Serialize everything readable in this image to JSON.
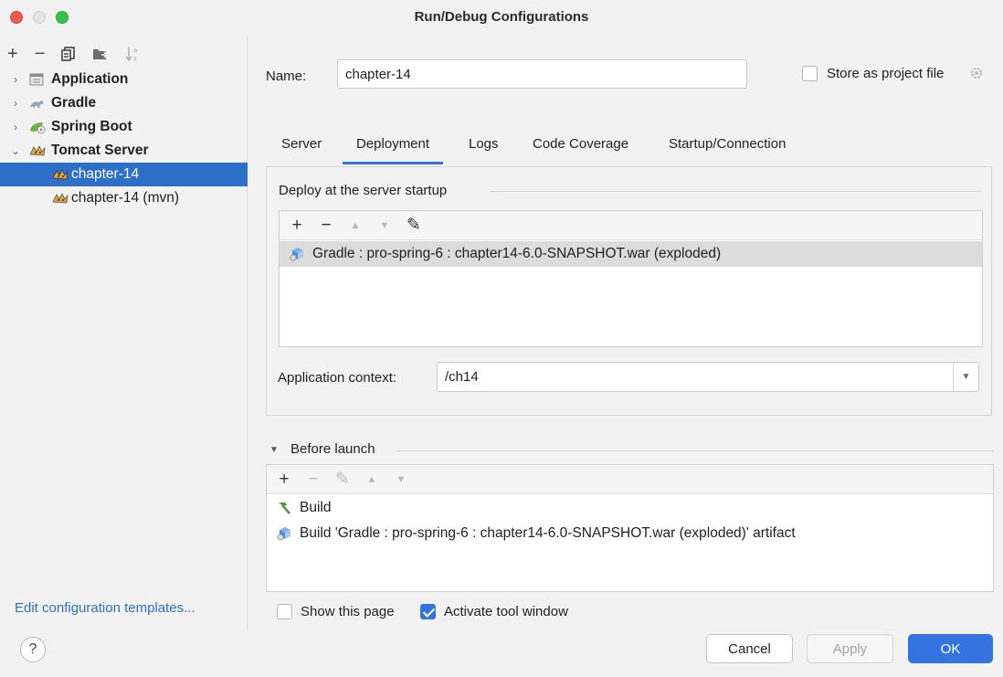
{
  "window": {
    "title": "Run/Debug Configurations"
  },
  "sidebar": {
    "toolbar": [
      {
        "name": "add-icon",
        "label": "+"
      },
      {
        "name": "remove-icon",
        "label": "−"
      },
      {
        "name": "copy-icon"
      },
      {
        "name": "move-to-folder-icon"
      },
      {
        "name": "sort-icon"
      }
    ],
    "tree": [
      {
        "label": "Application",
        "chevron": "›",
        "icon": "application-icon",
        "bold": true
      },
      {
        "label": "Gradle",
        "chevron": "›",
        "icon": "gradle-icon",
        "bold": true
      },
      {
        "label": "Spring Boot",
        "chevron": "›",
        "icon": "spring-boot-icon",
        "bold": true
      },
      {
        "label": "Tomcat Server",
        "chevron": "⌄",
        "icon": "tomcat-icon",
        "bold": true
      },
      {
        "label": "chapter-14",
        "icon": "tomcat-icon",
        "selected": true
      },
      {
        "label": "chapter-14 (mvn)",
        "icon": "tomcat-icon"
      }
    ],
    "edit_templates_link": "Edit configuration templates..."
  },
  "main": {
    "name_label": "Name:",
    "name_value": "chapter-14",
    "store_as_project_file": {
      "label": "Store as project file",
      "checked": false
    },
    "tabs": [
      {
        "label": "Server",
        "active": false
      },
      {
        "label": "Deployment",
        "active": true
      },
      {
        "label": "Logs",
        "active": false
      },
      {
        "label": "Code Coverage",
        "active": false
      },
      {
        "label": "Startup/Connection",
        "active": false
      }
    ],
    "deploy": {
      "section_title": "Deploy at the server startup",
      "toolbar": [
        {
          "label": "+",
          "enabled": true
        },
        {
          "label": "−",
          "enabled": true
        },
        {
          "label": "▲",
          "enabled": false
        },
        {
          "label": "▼",
          "enabled": false
        },
        {
          "label": "✎",
          "enabled": true
        }
      ],
      "items": [
        {
          "label": "Gradle : pro-spring-6 : chapter14-6.0-SNAPSHOT.war (exploded)",
          "icon": "artifact-icon",
          "selected": true
        }
      ],
      "app_context_label": "Application context:",
      "app_context_value": "/ch14"
    },
    "before_launch": {
      "section_title": "Before launch",
      "toolbar": [
        {
          "label": "+",
          "enabled": true
        },
        {
          "label": "−",
          "enabled": false
        },
        {
          "label": "✎",
          "enabled": false
        },
        {
          "label": "▲",
          "enabled": false
        },
        {
          "label": "▼",
          "enabled": false
        }
      ],
      "items": [
        {
          "label": "Build",
          "icon": "build-hammer-icon"
        },
        {
          "label": "Build 'Gradle : pro-spring-6 : chapter14-6.0-SNAPSHOT.war (exploded)' artifact",
          "icon": "artifact-icon"
        }
      ]
    },
    "show_this_page": {
      "label": "Show this page",
      "checked": false
    },
    "activate_tool_window": {
      "label": "Activate tool window",
      "checked": true
    }
  },
  "footer": {
    "help_label": "?",
    "cancel_label": "Cancel",
    "apply_label": "Apply",
    "ok_label": "OK"
  },
  "colors": {
    "accent": "#3574e0",
    "selection": "#2e6fc7",
    "close": "#ee5a52",
    "maximize": "#36c14a"
  }
}
